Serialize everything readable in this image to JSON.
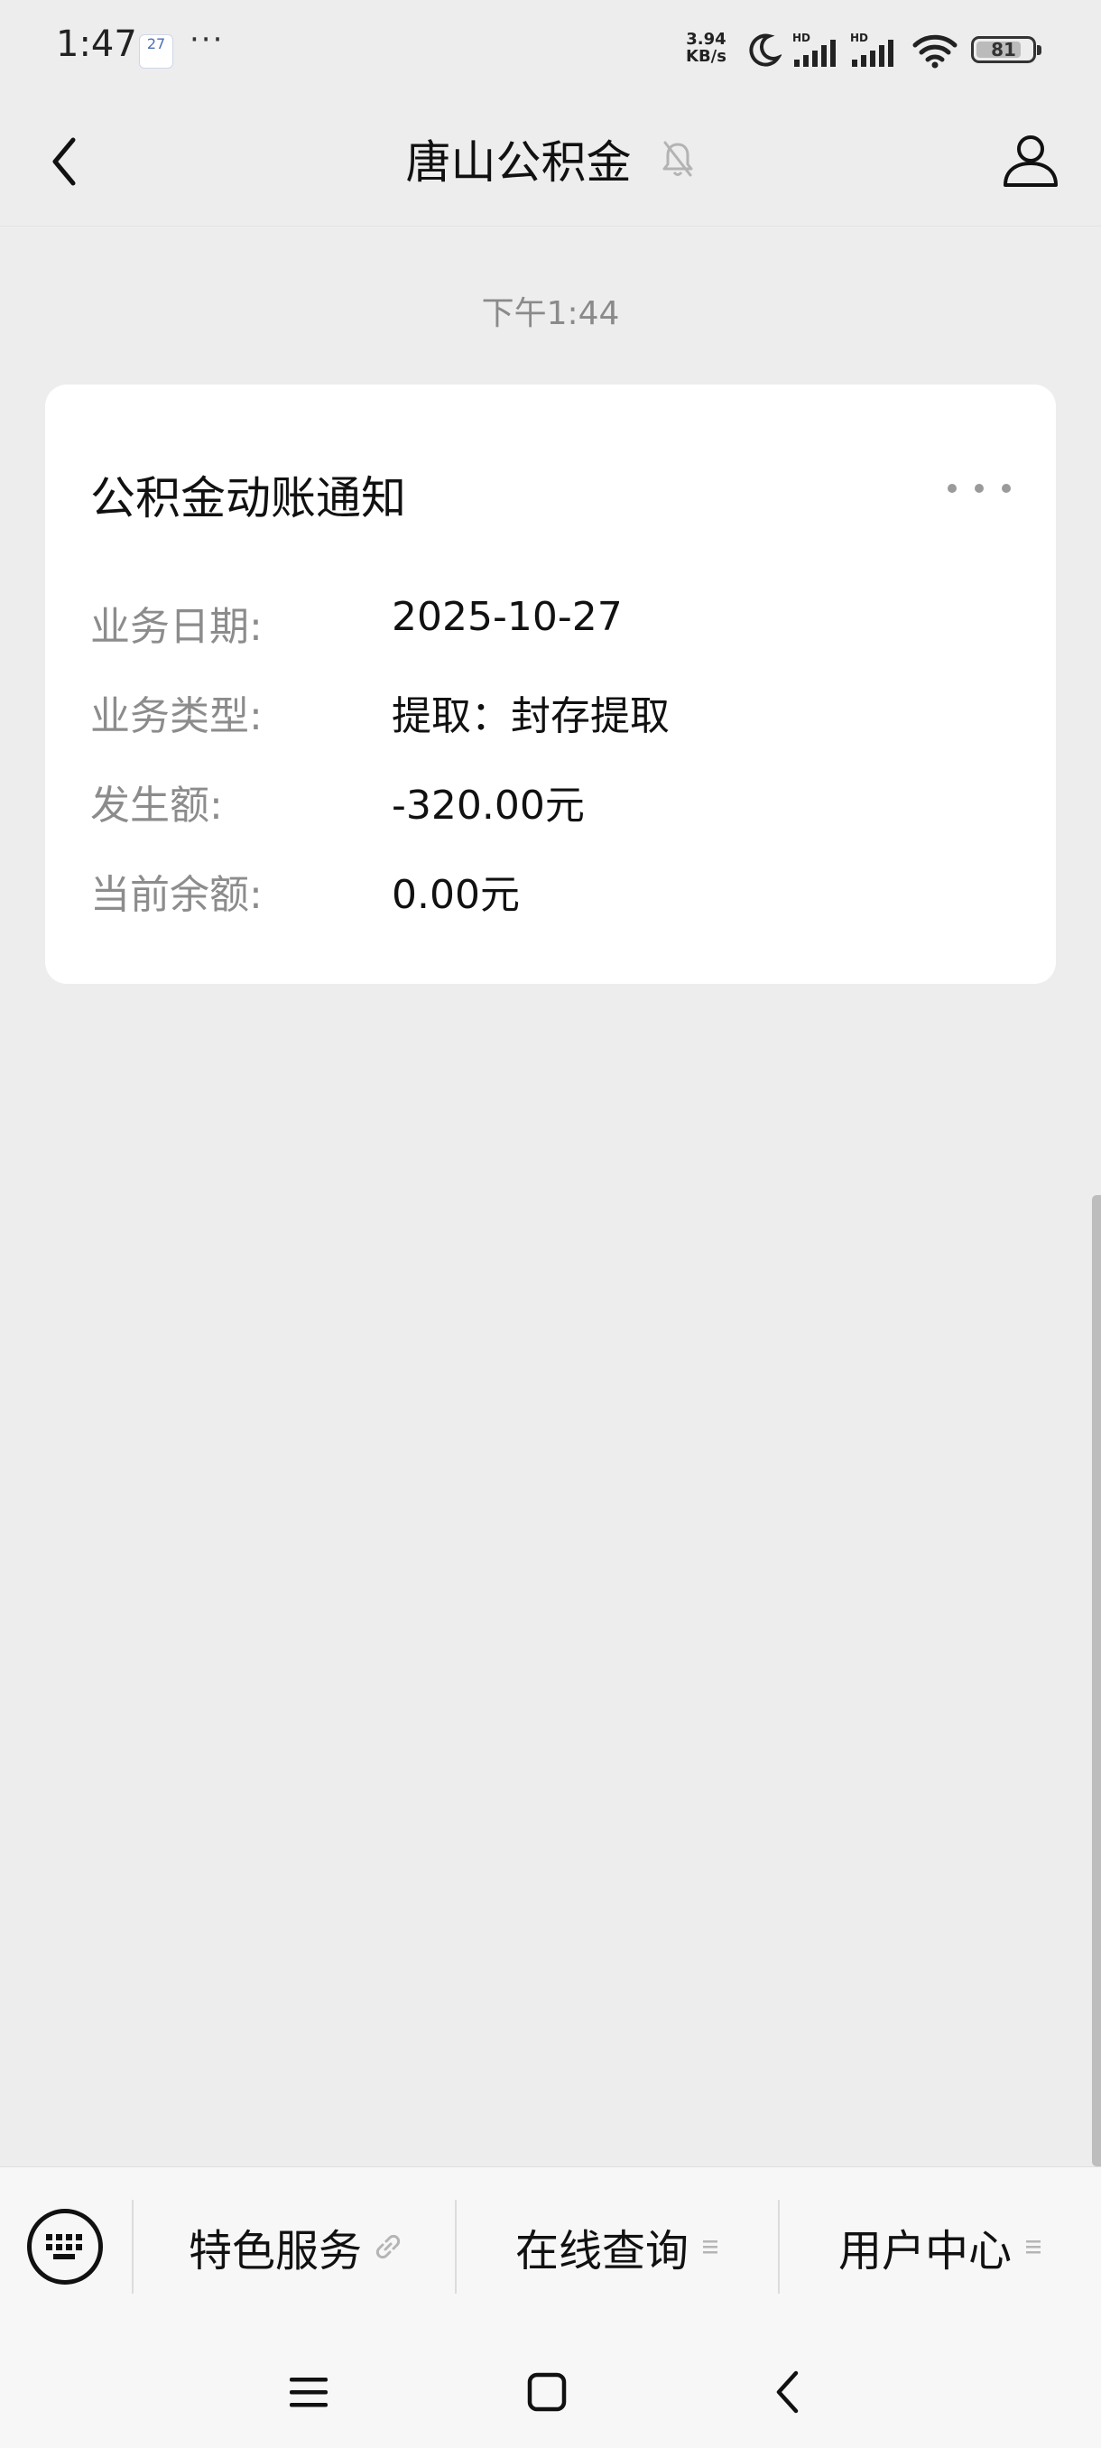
{
  "status_bar": {
    "time": "1:47",
    "calendar_badge": "27",
    "more_dots": "···",
    "net_speed_value": "3.94",
    "net_speed_unit": "KB/s",
    "signal_label_1": "HD",
    "signal_label_2": "HD",
    "battery_percent": 81
  },
  "nav": {
    "title": "唐山公积金"
  },
  "chat": {
    "timestamp": "下午1:44"
  },
  "notice_card": {
    "title": "公积金动账通知",
    "rows": [
      {
        "label": "业务日期:",
        "value": "2025-10-27"
      },
      {
        "label": "业务类型:",
        "value": "提取：封存提取"
      },
      {
        "label": "发生额:",
        "value": "-320.00元"
      },
      {
        "label": "当前余额:",
        "value": "0.00元"
      }
    ]
  },
  "bottom_menu": {
    "items": [
      {
        "label": "特色服务",
        "icon": "link-icon"
      },
      {
        "label": "在线查询",
        "icon": "menu-lines-icon"
      },
      {
        "label": "用户中心",
        "icon": "menu-lines-icon"
      }
    ]
  },
  "colors": {
    "background": "#ededed",
    "card": "#ffffff",
    "label_gray": "#8c8c8c",
    "text": "#111111"
  }
}
